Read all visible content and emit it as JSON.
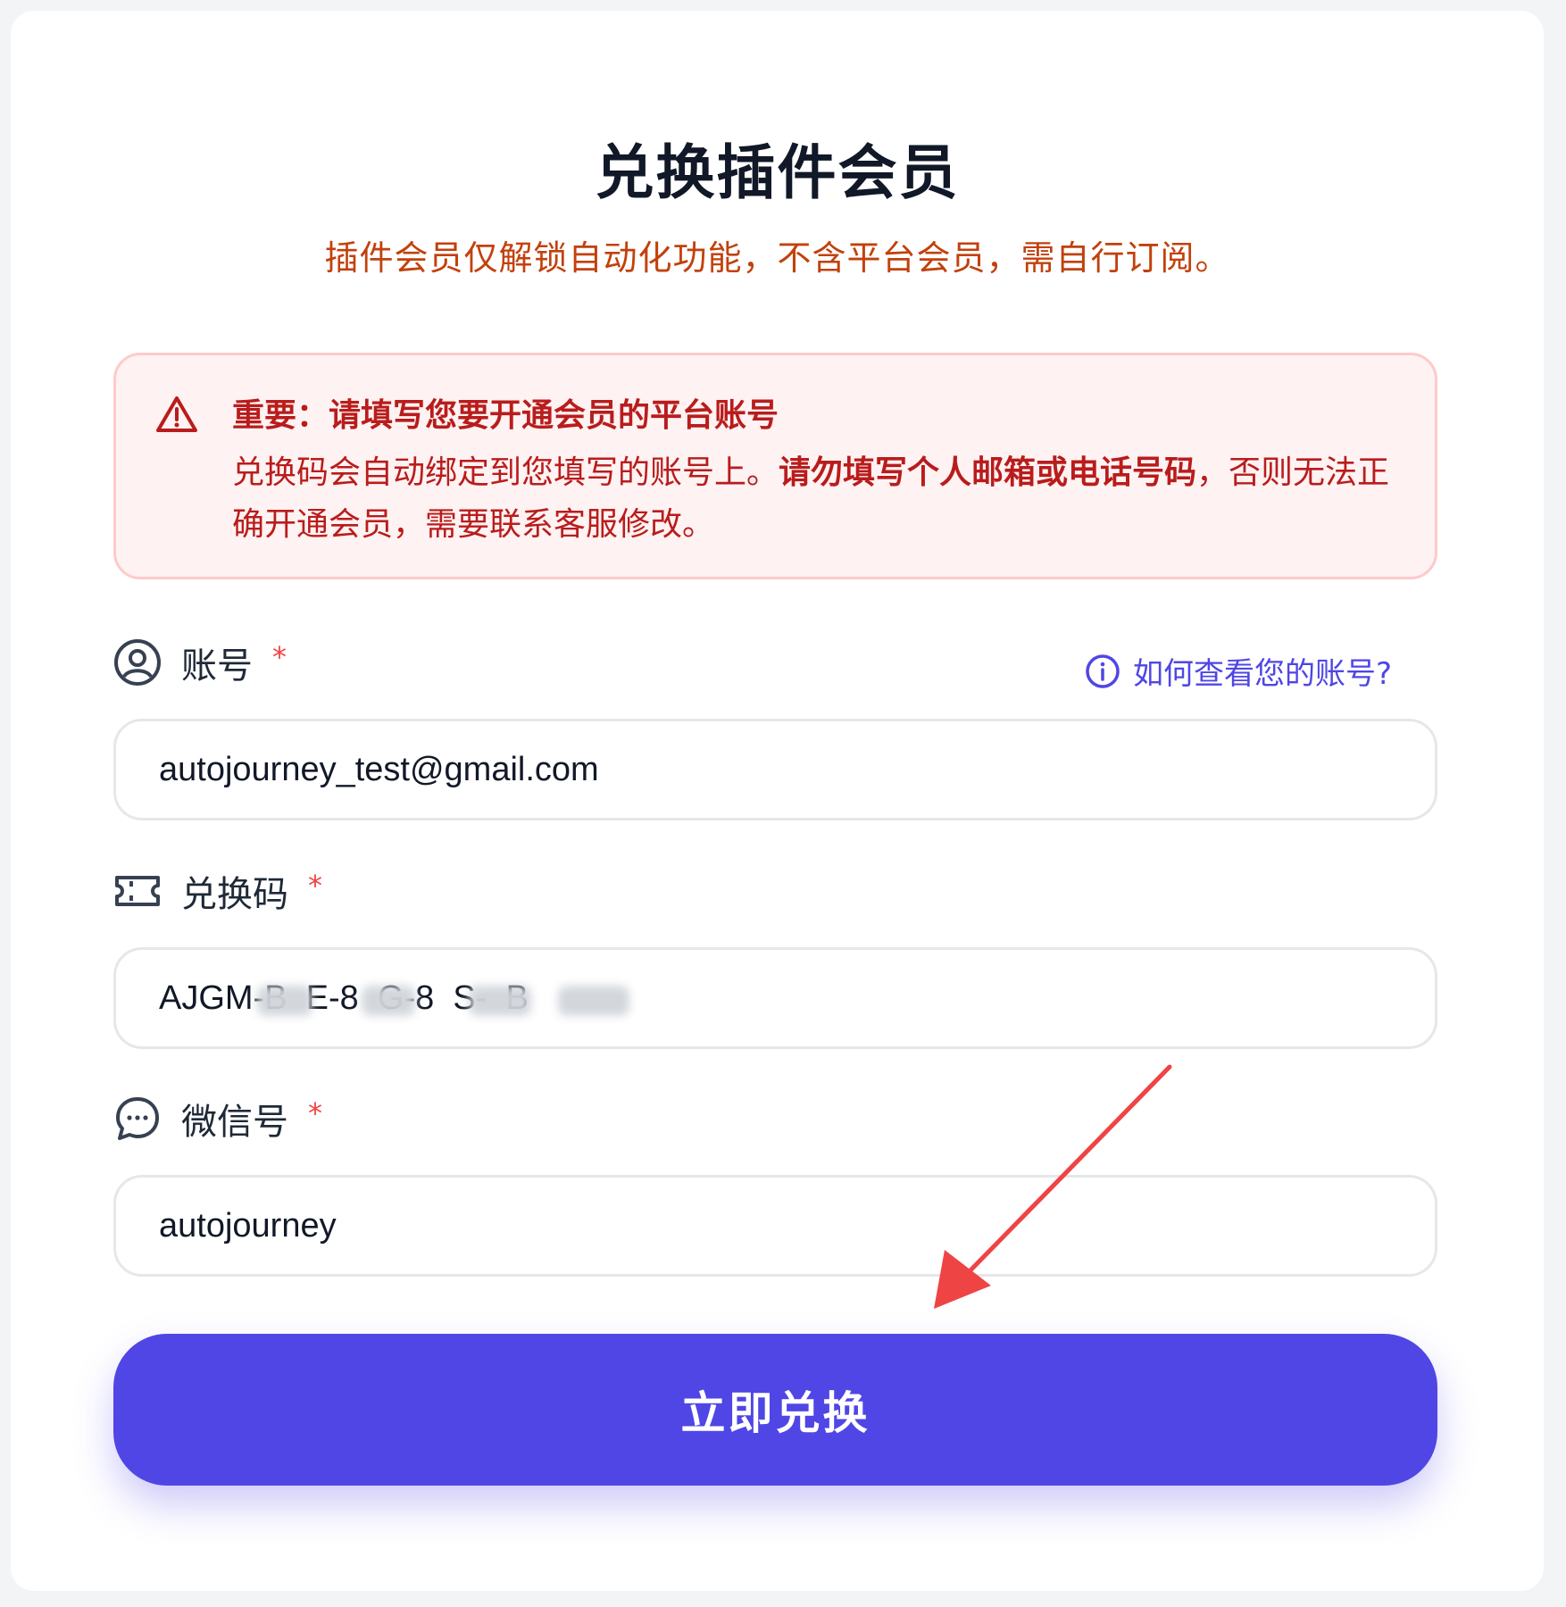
{
  "header": {
    "title": "兑换插件会员",
    "subtitle": "插件会员仅解锁自动化功能，不含平台会员，需自行订阅。"
  },
  "alert": {
    "title": "重要：请填写您要开通会员的平台账号",
    "body_prefix": "兑换码会自动绑定到您填写的账号上。",
    "body_bold": "请勿填写个人邮箱或电话号码",
    "body_suffix": "，否则无法正确开通会员，需要联系客服修改。",
    "icon": "warning-triangle-icon"
  },
  "fields": {
    "account": {
      "label": "账号",
      "required": "*",
      "value": "autojourney_test@gmail.com",
      "icon": "user-circle-icon",
      "help_text": "如何查看您的账号?",
      "help_icon": "info-icon"
    },
    "code": {
      "label": "兑换码",
      "required": "*",
      "value": "AJGM-B  E-8  G-8  S-  B",
      "icon": "ticket-icon"
    },
    "wechat": {
      "label": "微信号",
      "required": "*",
      "value": "autojourney",
      "icon": "chat-bubble-icon"
    }
  },
  "submit": {
    "label": "立即兑换"
  },
  "colors": {
    "primary": "#4f46e5",
    "alert_text": "#b91c1c",
    "alert_bg": "#fef2f2",
    "subtitle": "#c2410c",
    "annotation_arrow": "#ef4444"
  }
}
